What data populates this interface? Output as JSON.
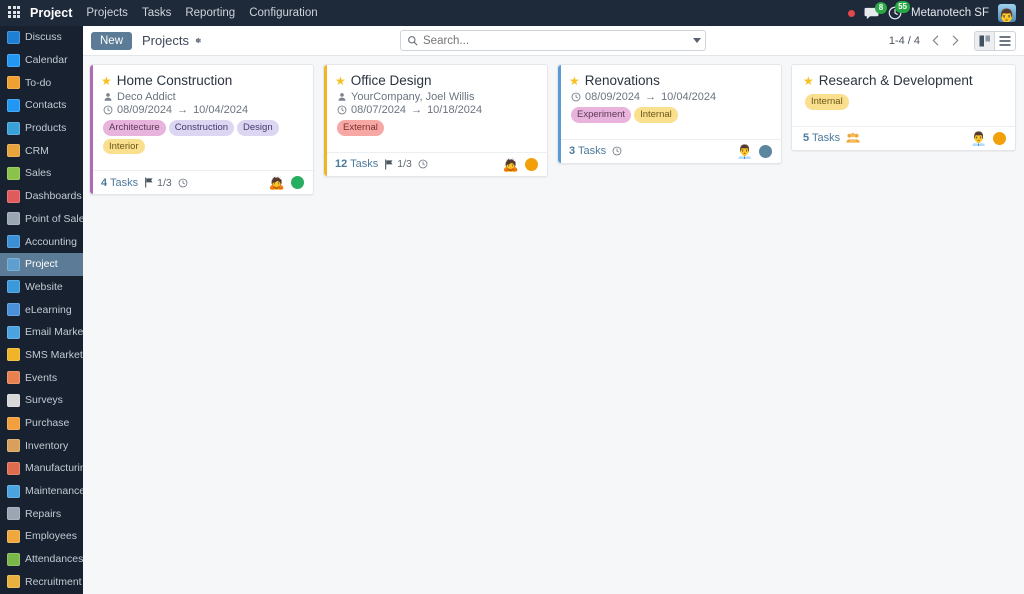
{
  "navbar": {
    "apps_icon": "apps-grid-icon",
    "brand": "Project",
    "menu": [
      "Projects",
      "Tasks",
      "Reporting",
      "Configuration"
    ],
    "status_dot": "red-status-dot",
    "messages_icon": "chat-icon",
    "messages_count": "8",
    "activities_icon": "clock-activity-icon",
    "activities_count": "55",
    "user_name": "Metanotech SF",
    "avatar": "user-avatar"
  },
  "sidebar": {
    "active": "Project",
    "items": [
      {
        "label": "Discuss",
        "icon": "discuss-icon",
        "color": "#1f7fd4"
      },
      {
        "label": "Calendar",
        "icon": "calendar-icon",
        "color": "#2196f3"
      },
      {
        "label": "To-do",
        "icon": "todo-icon",
        "color": "#f0a030"
      },
      {
        "label": "Contacts",
        "icon": "contacts-icon",
        "color": "#2196f3"
      },
      {
        "label": "Products",
        "icon": "products-icon",
        "color": "#3aa0d8"
      },
      {
        "label": "CRM",
        "icon": "crm-icon",
        "color": "#e8a33d"
      },
      {
        "label": "Sales",
        "icon": "sales-icon",
        "color": "#8bc34a"
      },
      {
        "label": "Dashboards",
        "icon": "dashboards-icon",
        "color": "#e05c5c"
      },
      {
        "label": "Point of Sale",
        "icon": "point-of-sale-icon",
        "color": "#9aa6b2"
      },
      {
        "label": "Accounting",
        "icon": "accounting-icon",
        "color": "#3b8fd4"
      },
      {
        "label": "Project",
        "icon": "project-icon",
        "color": "#5f9fd0"
      },
      {
        "label": "Website",
        "icon": "website-icon",
        "color": "#3a9ad9"
      },
      {
        "label": "eLearning",
        "icon": "elearning-icon",
        "color": "#4a90d9"
      },
      {
        "label": "Email Marketing",
        "icon": "email-marketing-icon",
        "color": "#4aa3df"
      },
      {
        "label": "SMS Marketing",
        "icon": "sms-marketing-icon",
        "color": "#f0b429"
      },
      {
        "label": "Events",
        "icon": "events-icon",
        "color": "#e8804f"
      },
      {
        "label": "Surveys",
        "icon": "surveys-icon",
        "color": "#d8d8d8"
      },
      {
        "label": "Purchase",
        "icon": "purchase-icon",
        "color": "#f29f3d"
      },
      {
        "label": "Inventory",
        "icon": "inventory-icon",
        "color": "#d9a05b"
      },
      {
        "label": "Manufacturing",
        "icon": "manufacturing-icon",
        "color": "#e06c4f"
      },
      {
        "label": "Maintenance",
        "icon": "maintenance-icon",
        "color": "#4aa3df"
      },
      {
        "label": "Repairs",
        "icon": "repairs-icon",
        "color": "#9aa6b2"
      },
      {
        "label": "Employees",
        "icon": "employees-icon",
        "color": "#f0a83d"
      },
      {
        "label": "Attendances",
        "icon": "attendances-icon",
        "color": "#7ab648"
      },
      {
        "label": "Recruitment",
        "icon": "recruitment-icon",
        "color": "#e8b03d"
      }
    ]
  },
  "control_panel": {
    "new_label": "New",
    "breadcrumb": "Projects",
    "settings_icon": "gear-icon",
    "search": {
      "icon": "search-icon",
      "value": "",
      "placeholder": "Search...",
      "dropdown_icon": "chevron-down-icon"
    },
    "pager": {
      "range": "1-4 / 4",
      "prev_icon": "chevron-left-icon",
      "next_icon": "chevron-right-icon"
    },
    "views": [
      {
        "name": "kanban",
        "icon": "kanban-view-icon",
        "active": true
      },
      {
        "name": "list",
        "icon": "list-view-icon",
        "active": false
      }
    ]
  },
  "kanban": {
    "cards": [
      {
        "title": "Home Construction",
        "favorite_icon": "star-icon",
        "customer_icon": "person-icon",
        "customer": "Deco Addict",
        "date_icon": "clock-icon",
        "date_start": "08/09/2024",
        "date_arrow": "→",
        "date_end": "10/04/2024",
        "tags": [
          {
            "label": "Architecture",
            "bg": "#e8b3dd",
            "fg": "#5c3a57"
          },
          {
            "label": "Construction",
            "bg": "#ddd6f3",
            "fg": "#443a6b"
          },
          {
            "label": "Design",
            "bg": "#ddd6f3",
            "fg": "#443a6b"
          },
          {
            "label": "Interior",
            "bg": "#fadf8e",
            "fg": "#6b5718"
          }
        ],
        "stripe": "#b06bb5",
        "tasks_count": "4",
        "tasks_label": "Tasks",
        "milestone_icon": "flag-icon",
        "milestone": "1/3",
        "timesheet_icon": "clock-icon",
        "assignee_icon": "assignee-avatar",
        "assignee_emoji": "🙇",
        "status_color": "#27ae60"
      },
      {
        "title": "Office Design",
        "favorite_icon": "star-icon",
        "customer_icon": "person-icon",
        "customer": "YourCompany, Joel Willis",
        "date_icon": "clock-icon",
        "date_start": "08/07/2024",
        "date_arrow": "→",
        "date_end": "10/18/2024",
        "tags": [
          {
            "label": "External",
            "bg": "#f7a8a5",
            "fg": "#7a2f2d"
          }
        ],
        "stripe": "#f0b429",
        "tasks_count": "12",
        "tasks_label": "Tasks",
        "milestone_icon": "flag-icon",
        "milestone": "1/3",
        "timesheet_icon": "clock-icon",
        "assignee_icon": "assignee-avatar",
        "assignee_emoji": "🙇",
        "status_color": "#f1a009"
      },
      {
        "title": "Renovations",
        "favorite_icon": "star-icon",
        "customer_icon": "",
        "customer": "",
        "date_icon": "clock-icon",
        "date_start": "08/09/2024",
        "date_arrow": "→",
        "date_end": "10/04/2024",
        "tags": [
          {
            "label": "Experiment",
            "bg": "#e8b3dd",
            "fg": "#5c3a57"
          },
          {
            "label": "Internal",
            "bg": "#fadf8e",
            "fg": "#6b5718"
          }
        ],
        "stripe": "#5b9bd5",
        "tasks_count": "3",
        "tasks_label": "Tasks",
        "milestone_icon": "",
        "milestone": "",
        "timesheet_icon": "clock-icon",
        "assignee_icon": "assignee-avatar",
        "assignee_emoji": "👨‍💼",
        "status_color": "#5a86a0"
      },
      {
        "title": "Research & Development",
        "favorite_icon": "star-icon",
        "customer_icon": "",
        "customer": "",
        "date_icon": "",
        "date_start": "",
        "date_arrow": "",
        "date_end": "",
        "tags": [
          {
            "label": "Internal",
            "bg": "#fadf8e",
            "fg": "#6b5718"
          }
        ],
        "stripe": "",
        "tasks_count": "5",
        "tasks_label": "Tasks",
        "milestone_icon": "people-group-icon",
        "milestone": "",
        "timesheet_icon": "",
        "assignee_icon": "assignee-avatar",
        "assignee_emoji": "👨‍💼",
        "status_color": "#f1a009"
      }
    ]
  }
}
